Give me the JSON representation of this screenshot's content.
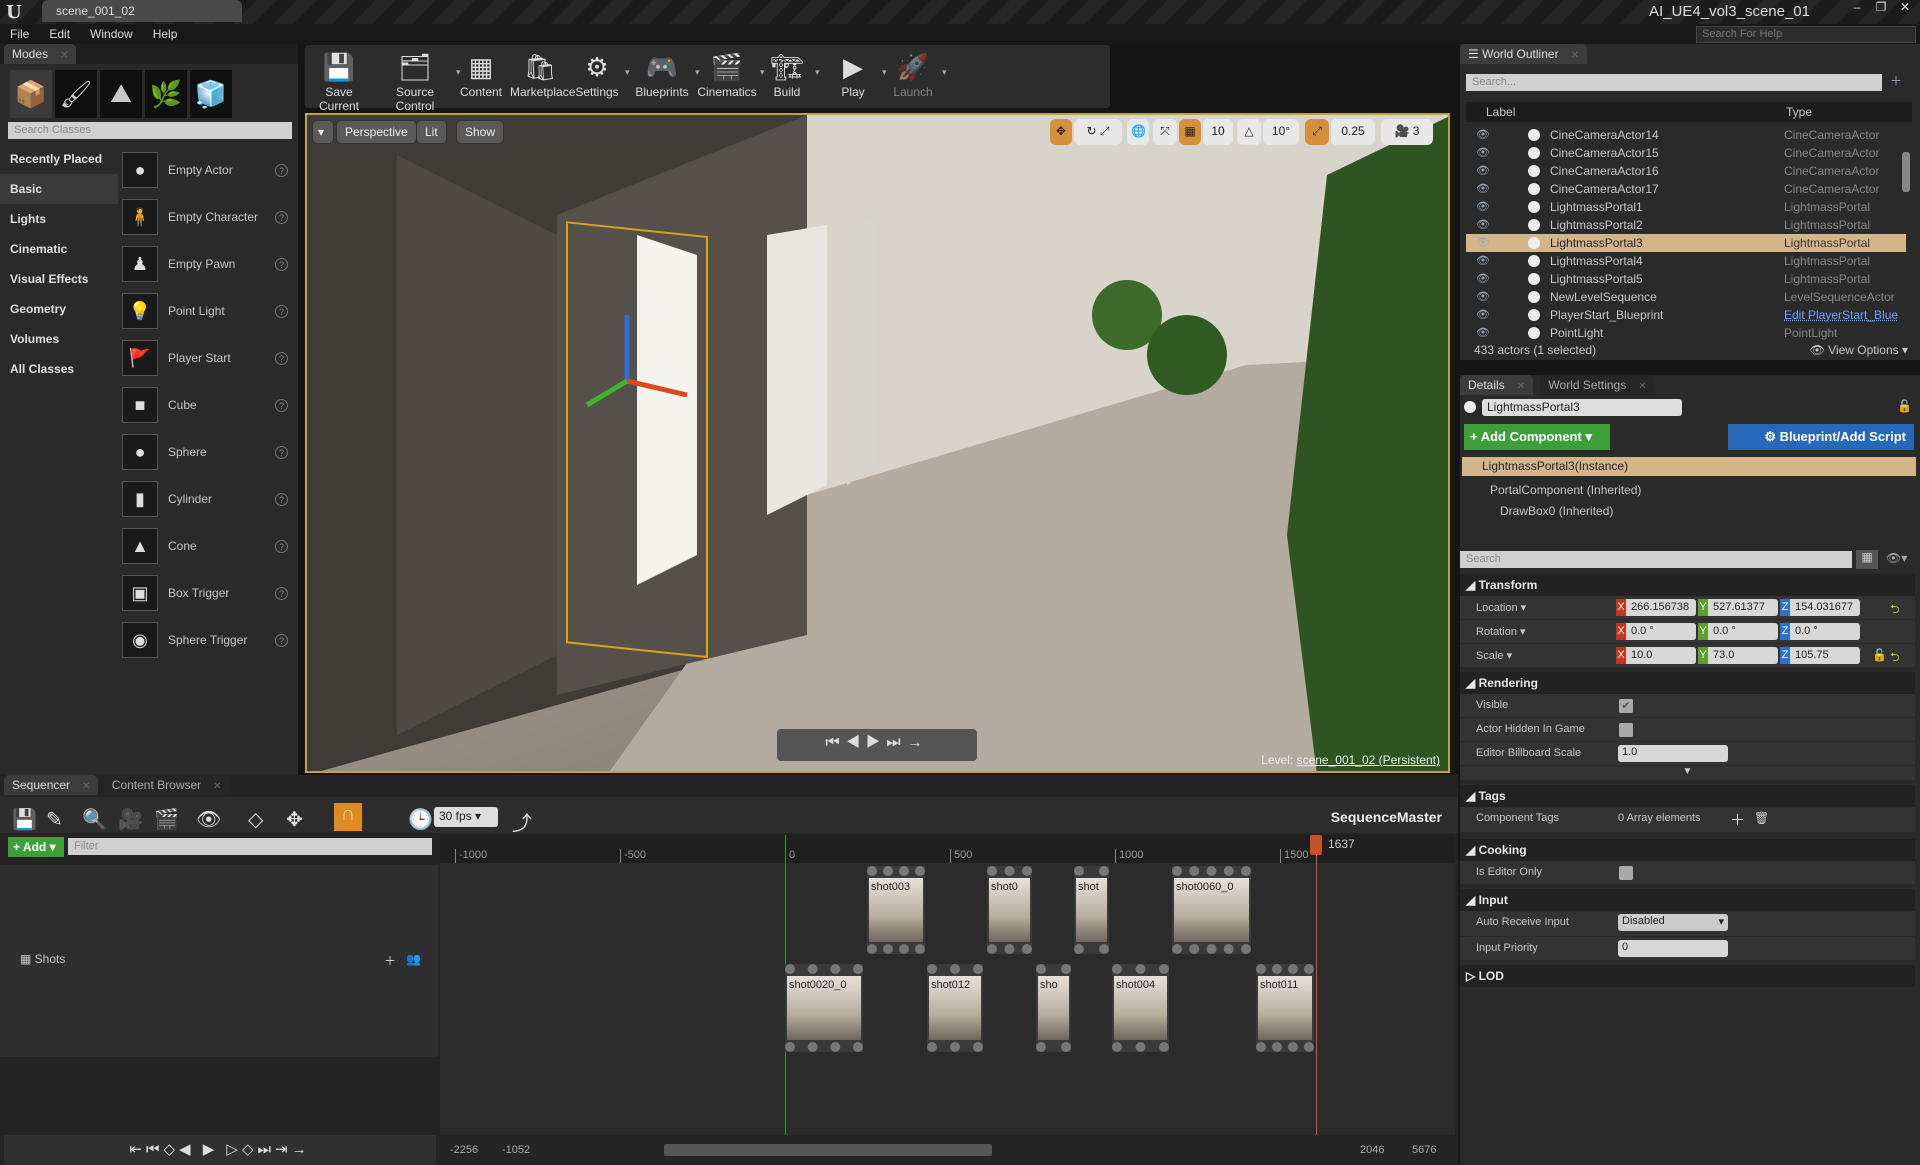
{
  "window": {
    "tab": "scene_001_02",
    "title": "AI_UE4_vol3_scene_01",
    "help_search_placeholder": "Search For Help",
    "controls": [
      "–",
      "❐",
      "✕"
    ]
  },
  "menu": [
    "File",
    "Edit",
    "Window",
    "Help"
  ],
  "modes": {
    "tab": "Modes",
    "search_placeholder": "Search Classes",
    "categories": [
      "Recently Placed",
      "Basic",
      "Lights",
      "Cinematic",
      "Visual Effects",
      "Geometry",
      "Volumes",
      "All Classes"
    ],
    "selected_category": "Basic",
    "classes": [
      "Empty Actor",
      "Empty Character",
      "Empty Pawn",
      "Point Light",
      "Player Start",
      "Cube",
      "Sphere",
      "Cylinder",
      "Cone",
      "Box Trigger",
      "Sphere Trigger"
    ]
  },
  "toolbar": [
    "Save Current",
    "Source Control",
    "Content",
    "Marketplace",
    "Settings",
    "Blueprints",
    "Cinematics",
    "Build",
    "Play",
    "Launch"
  ],
  "viewport": {
    "buttons": [
      "Perspective",
      "Lit",
      "Show"
    ],
    "grid_snap": "10",
    "rot_snap": "10°",
    "scale_snap": "0.25",
    "cam_speed": "3",
    "level_prefix": "Level:",
    "level_name": "scene_001_02 (Persistent)"
  },
  "outliner": {
    "tab": "World Outliner",
    "search_placeholder": "Search...",
    "col_label": "Label",
    "col_type": "Type",
    "rows": [
      {
        "label": "CineCameraActor14",
        "type": "CineCameraActor"
      },
      {
        "label": "CineCameraActor15",
        "type": "CineCameraActor"
      },
      {
        "label": "CineCameraActor16",
        "type": "CineCameraActor"
      },
      {
        "label": "CineCameraActor17",
        "type": "CineCameraActor"
      },
      {
        "label": "LightmassPortal1",
        "type": "LightmassPortal"
      },
      {
        "label": "LightmassPortal2",
        "type": "LightmassPortal"
      },
      {
        "label": "LightmassPortal3",
        "type": "LightmassPortal",
        "selected": true
      },
      {
        "label": "LightmassPortal4",
        "type": "LightmassPortal"
      },
      {
        "label": "LightmassPortal5",
        "type": "LightmassPortal"
      },
      {
        "label": "NewLevelSequence",
        "type": "LevelSequenceActor"
      },
      {
        "label": "PlayerStart_Blueprint",
        "type": "Edit PlayerStart_Blue",
        "link": true
      },
      {
        "label": "PointLight",
        "type": "PointLight"
      }
    ],
    "status": "433 actors (1 selected)",
    "view_options": "View Options"
  },
  "details": {
    "tab": "Details",
    "tab2": "World Settings",
    "name": "LightmassPortal3",
    "add_component": "+ Add Component",
    "blueprint": "Blueprint/Add Script",
    "components": [
      "LightmassPortal3(Instance)",
      "PortalComponent (Inherited)",
      "DrawBox0 (Inherited)"
    ],
    "search_placeholder": "Search",
    "transform": {
      "title": "Transform",
      "location_label": "Location",
      "rotation_label": "Rotation",
      "scale_label": "Scale",
      "location": [
        "266.156738",
        "527.61377",
        "154.031677"
      ],
      "rotation": [
        "0.0 °",
        "0.0 °",
        "0.0 °"
      ],
      "scale": [
        "10.0",
        "73.0",
        "105.75"
      ]
    },
    "rendering": {
      "title": "Rendering",
      "visible_label": "Visible",
      "visible": true,
      "hidden_label": "Actor Hidden In Game",
      "hidden": false,
      "billboard_label": "Editor Billboard Scale",
      "billboard": "1.0"
    },
    "tags": {
      "title": "Tags",
      "label": "Component Tags",
      "value": "0 Array elements"
    },
    "cooking": {
      "title": "Cooking",
      "label": "Is Editor Only",
      "value": false
    },
    "input": {
      "title": "Input",
      "auto_label": "Auto Receive Input",
      "auto_value": "Disabled",
      "priority_label": "Input Priority",
      "priority_value": "0"
    },
    "lod": {
      "title": "LOD"
    }
  },
  "sequencer": {
    "tab": "Sequencer",
    "tab2": "Content Browser",
    "fps": "30 fps",
    "add": "+ Add",
    "filter_placeholder": "Filter",
    "master": "SequenceMaster",
    "track": "Shots",
    "ruler_ticks": [
      "-1000",
      "-500",
      "0",
      "500",
      "1000",
      "1500"
    ],
    "playhead": "1637",
    "view_range": [
      "-2256",
      "-1052",
      "2046",
      "5676"
    ],
    "shots_top": [
      "shot003",
      "shot0",
      "shot",
      "shot0060_0"
    ],
    "shots_bottom": [
      "shot0020_0",
      "shot012",
      "sho",
      "shot004",
      "shot011"
    ]
  }
}
